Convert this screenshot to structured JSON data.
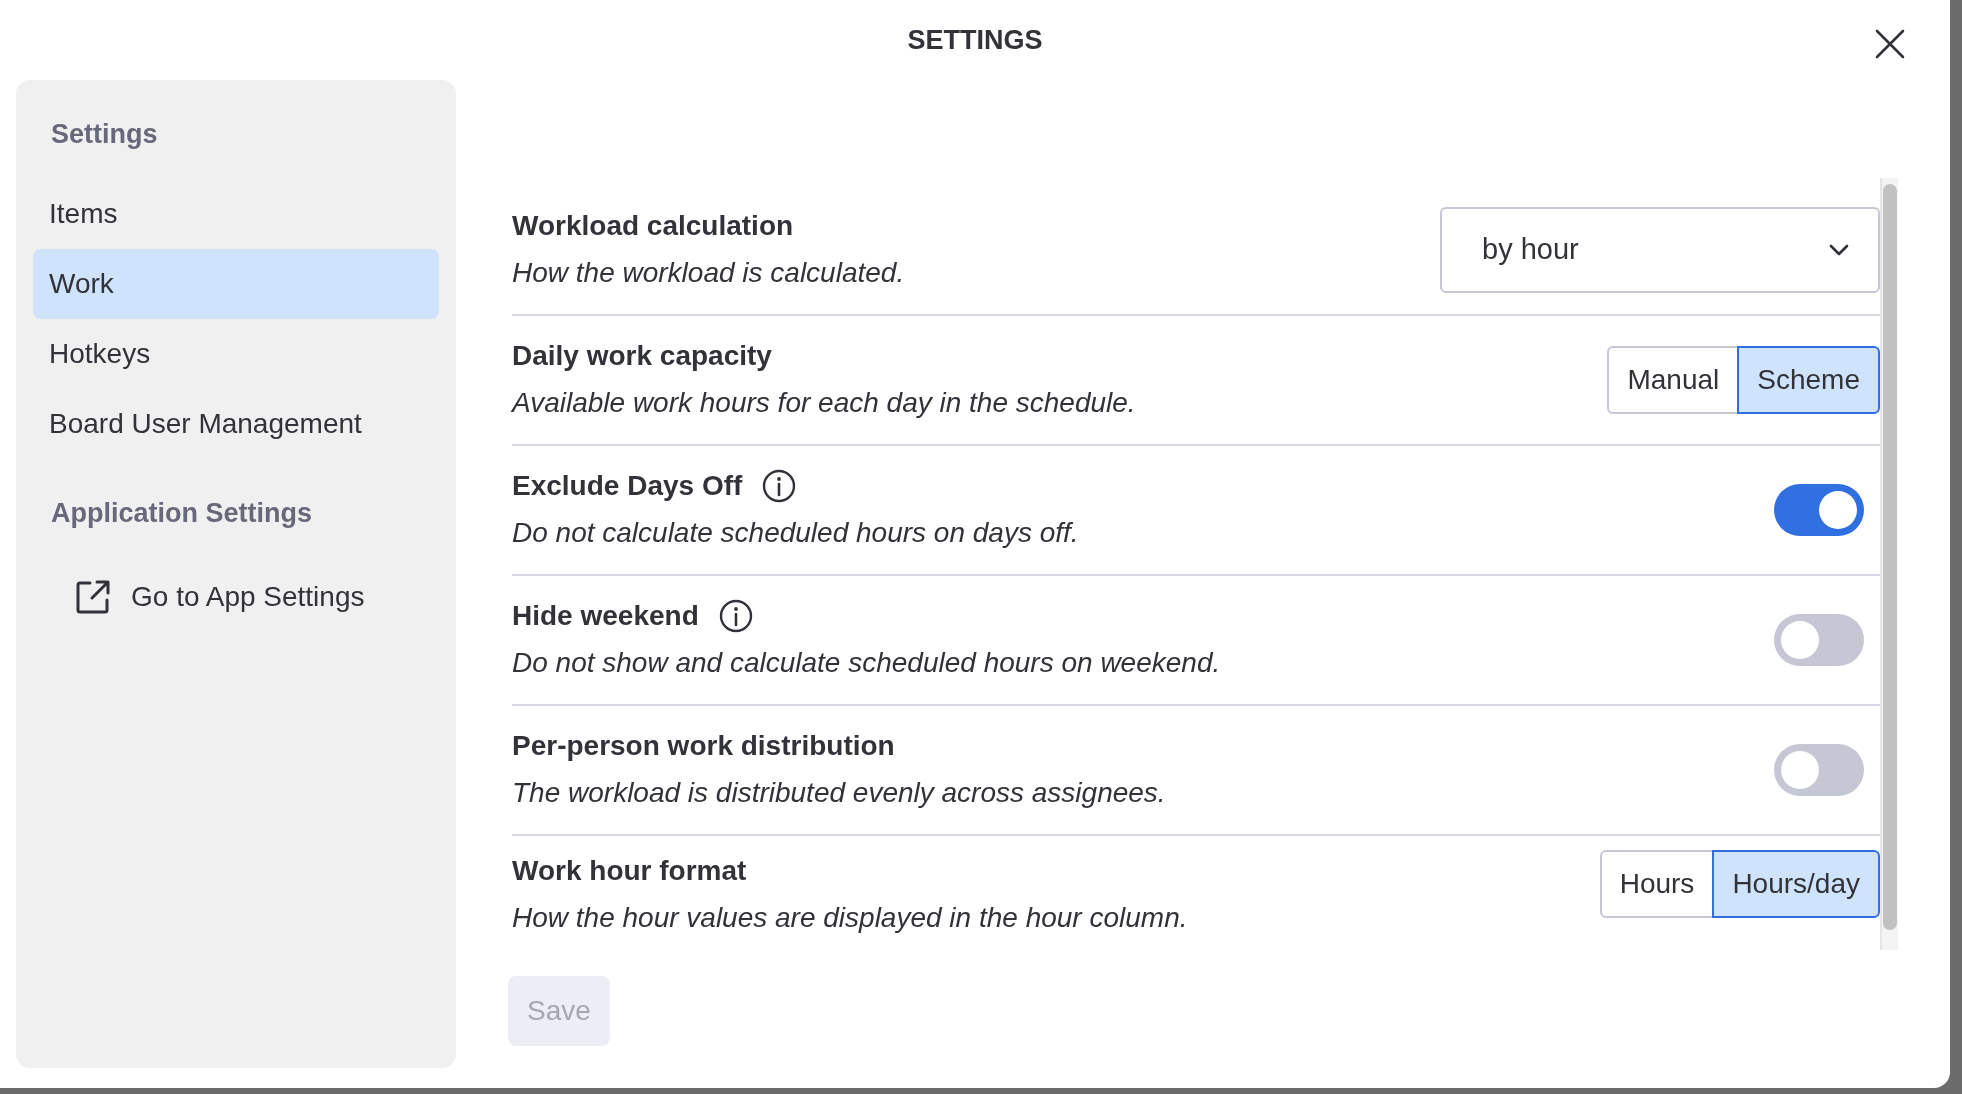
{
  "title": "SETTINGS",
  "sidebar": {
    "sections": [
      {
        "heading": "Settings",
        "items": [
          {
            "label": "Items",
            "selected": false,
            "kind": "plain"
          },
          {
            "label": "Work",
            "selected": true,
            "kind": "plain"
          },
          {
            "label": "Hotkeys",
            "selected": false,
            "kind": "plain"
          },
          {
            "label": "Board User Management",
            "selected": false,
            "kind": "plain"
          }
        ]
      },
      {
        "heading": "Application Settings",
        "items": [
          {
            "label": "Go to App Settings",
            "selected": false,
            "kind": "external"
          }
        ]
      }
    ]
  },
  "settings": [
    {
      "title": "Workload calculation",
      "description": "How the workload is calculated.",
      "info": false,
      "kind": "dropdown",
      "value": "by hour"
    },
    {
      "title": "Daily work capacity",
      "description": "Available work hours for each day in the schedule.",
      "info": false,
      "kind": "segmented",
      "options": [
        {
          "label": "Manual",
          "selected": false
        },
        {
          "label": "Scheme",
          "selected": true
        }
      ]
    },
    {
      "title": "Exclude Days Off",
      "description": "Do not calculate scheduled hours on days off.",
      "info": true,
      "kind": "toggle",
      "on": true
    },
    {
      "title": "Hide weekend",
      "description": "Do not show and calculate scheduled hours on weekend.",
      "info": true,
      "kind": "toggle",
      "on": false
    },
    {
      "title": "Per-person work distribution",
      "description": "The workload is distributed evenly across assignees.",
      "info": false,
      "kind": "toggle",
      "on": false
    },
    {
      "title": "Work hour format",
      "description": "How the hour values are displayed in the hour column.",
      "info": false,
      "kind": "segmented",
      "options": [
        {
          "label": "Hours",
          "selected": false
        },
        {
          "label": "Hours/day",
          "selected": true
        }
      ]
    }
  ],
  "save_button": {
    "label": "Save",
    "disabled": true
  }
}
